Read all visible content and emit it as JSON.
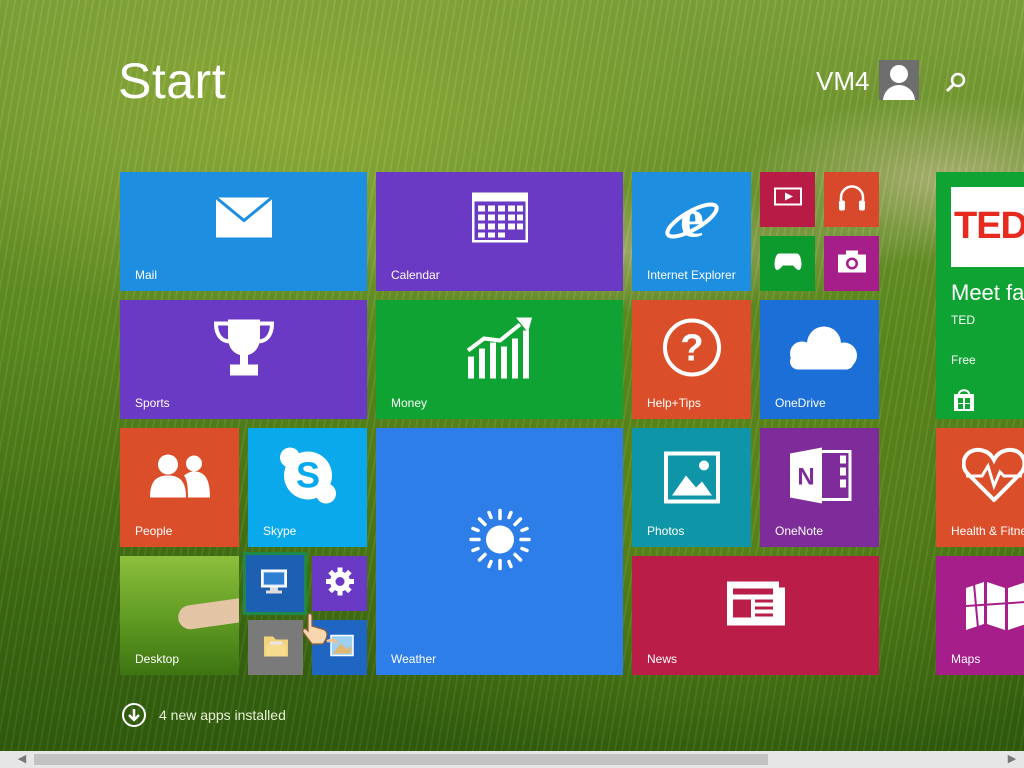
{
  "header": {
    "title": "Start",
    "user_name": "VM4"
  },
  "tiles": {
    "mail": "Mail",
    "calendar": "Calendar",
    "ie": "Internet Explorer",
    "sports": "Sports",
    "money": "Money",
    "help": "Help+Tips",
    "onedrive": "OneDrive",
    "people": "People",
    "skype": "Skype",
    "weather": "Weather",
    "photos": "Photos",
    "onenote": "OneNote",
    "desktop": "Desktop",
    "news": "News",
    "health": "Health & Fitne",
    "maps": "Maps"
  },
  "ted_tile": {
    "logo": "TED",
    "headline": "Meet fas",
    "publisher": "TED",
    "price": "Free"
  },
  "footer": {
    "installed_text": "4 new apps installed"
  },
  "colors": {
    "blue": "#1d8ee0",
    "purple": "#6d3bc6",
    "green": "#0ea332",
    "orange": "#db4e2a",
    "crimson": "#ba1e48",
    "weather_blue": "#2d7ee8",
    "teal": "#0e96a8",
    "onenote": "#7d2c99"
  }
}
